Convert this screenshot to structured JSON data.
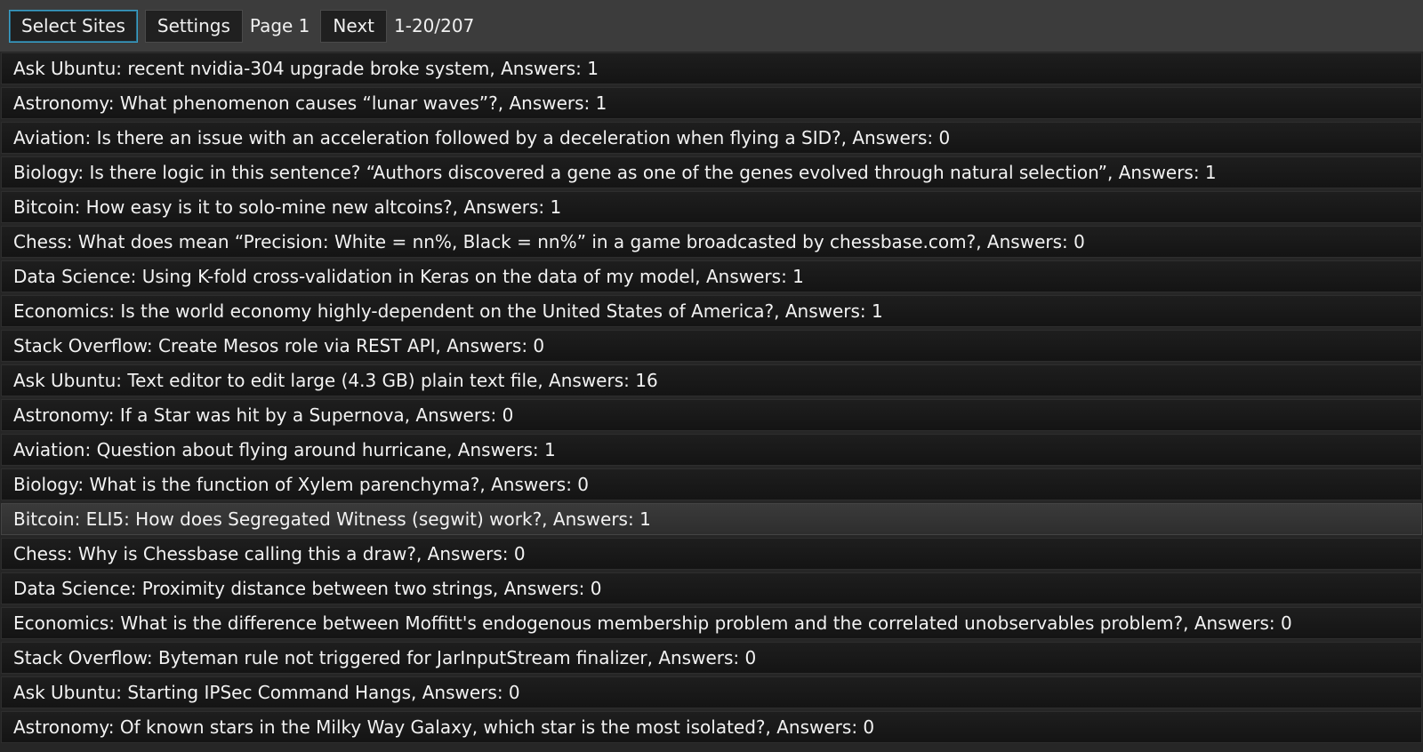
{
  "toolbar": {
    "select_sites_label": "Select Sites",
    "settings_label": "Settings",
    "page_label": "Page 1",
    "next_label": "Next",
    "range_label": "1-20/207"
  },
  "questions": [
    "Ask Ubuntu: recent nvidia-304 upgrade broke system, Answers: 1",
    "Astronomy: What phenomenon causes “lunar waves”?, Answers: 1",
    "Aviation: Is there an issue with an acceleration followed by a deceleration when flying a SID?, Answers: 0",
    "Biology: Is there logic in this sentence? “Authors discovered a gene as one of the genes evolved through natural selection”, Answers: 1",
    "Bitcoin: How easy is it to solo-mine new altcoins?, Answers: 1",
    "Chess: What does mean “Precision: White = nn%, Black = nn%” in a game broadcasted by chessbase.com?, Answers: 0",
    "Data Science: Using K-fold cross-validation in Keras on the data of my model, Answers: 1",
    "Economics: Is the world economy highly-dependent on the United States of America?, Answers: 1",
    "Stack Overflow: Create Mesos role via REST API, Answers: 0",
    "Ask Ubuntu: Text editor to edit large (4.3 GB) plain text file, Answers: 16",
    "Astronomy: If a Star was hit by a Supernova, Answers: 0",
    "Aviation: Question about flying around hurricane, Answers: 1",
    "Biology: What is the function of Xylem parenchyma?, Answers: 0",
    "Bitcoin: ELI5: How does Segregated Witness (segwit) work?, Answers: 1",
    "Chess: Why is Chessbase calling this a draw?, Answers: 0",
    "Data Science: Proximity distance between two strings, Answers: 0",
    "Economics: What is the difference between Moffitt's endogenous membership problem and the correlated unobservables problem?, Answers: 0",
    "Stack Overflow: Byteman rule not triggered for JarInputStream finalizer, Answers: 0",
    "Ask Ubuntu: Starting IPSec Command Hangs, Answers: 0",
    "Astronomy: Of known stars in the Milky Way Galaxy, which star is the most isolated?, Answers: 0"
  ]
}
